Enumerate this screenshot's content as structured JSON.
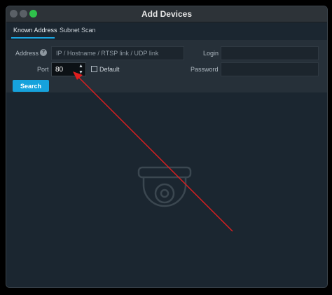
{
  "window": {
    "title": "Add Devices"
  },
  "tabs": [
    {
      "label": "Known Address",
      "active": true
    },
    {
      "label": "Subnet Scan",
      "active": false
    }
  ],
  "form": {
    "address_label": "Address",
    "address_placeholder": "IP / Hostname / RTSP link / UDP link",
    "address_value": "",
    "port_label": "Port",
    "port_value": "80",
    "default_label": "Default",
    "default_checked": false,
    "login_label": "Login",
    "login_value": "",
    "password_label": "Password",
    "password_value": "",
    "search_label": "Search"
  },
  "content": {
    "empty_state_icon": "dome-camera-icon"
  },
  "annotation": {
    "arrow_color": "#e01e1e"
  },
  "colors": {
    "accent": "#16a2dc",
    "window_bg": "#1b2630",
    "panel_bg": "#263039"
  }
}
